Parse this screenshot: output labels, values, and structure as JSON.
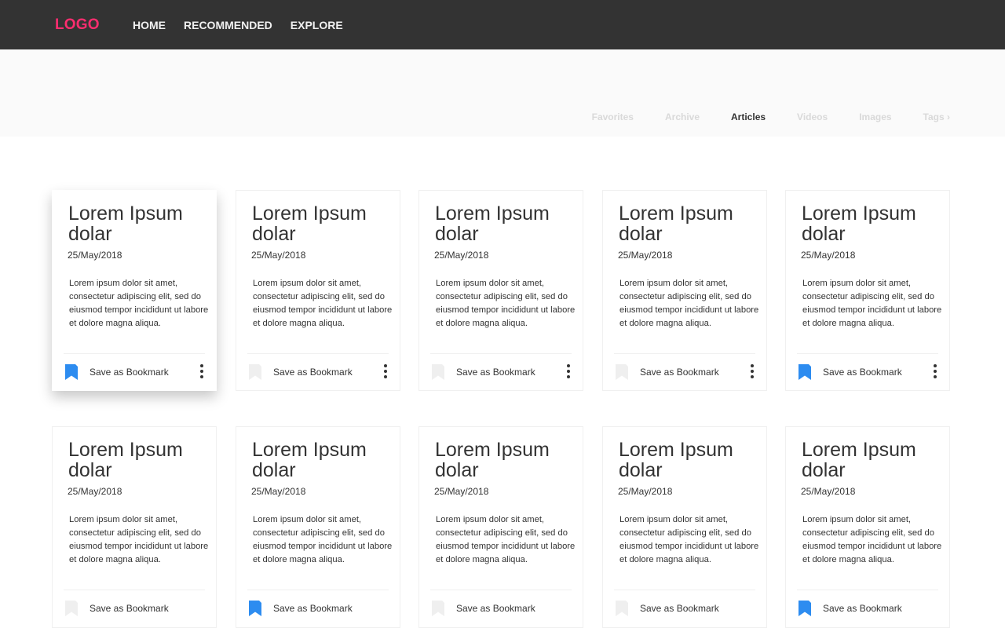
{
  "header": {
    "logo": "LOGO",
    "nav": [
      "HOME",
      "RECOMMENDED",
      "EXPLORE"
    ]
  },
  "filters": {
    "tabs": [
      "Favorites",
      "Archive",
      "Articles",
      "Videos",
      "Images",
      "Tags ›"
    ],
    "active": "Articles"
  },
  "colors": {
    "topbar": "#333333",
    "logo": "#ff2d6f",
    "bookmark_active": "#2d8cf0",
    "bookmark_inactive": "#efefef"
  },
  "cards": [
    {
      "title": "Lorem Ipsum dolar",
      "date": "25/May/2018",
      "body": "Lorem ipsum dolor sit amet, consectetur adipiscing elit, sed do eiusmod tempor incididunt ut labore et dolore magna aliqua.",
      "bookmark_label": "Save as Bookmark",
      "bookmarked": true,
      "raised": true,
      "more_menu": true
    },
    {
      "title": "Lorem Ipsum dolar",
      "date": "25/May/2018",
      "body": "Lorem ipsum dolor sit amet, consectetur adipiscing elit, sed do eiusmod tempor incididunt ut labore et dolore magna aliqua.",
      "bookmark_label": "Save as Bookmark",
      "bookmarked": false,
      "raised": false,
      "more_menu": true
    },
    {
      "title": "Lorem Ipsum dolar",
      "date": "25/May/2018",
      "body": "Lorem ipsum dolor sit amet, consectetur adipiscing elit, sed do eiusmod tempor incididunt ut labore et dolore magna aliqua.",
      "bookmark_label": "Save as Bookmark",
      "bookmarked": false,
      "raised": false,
      "more_menu": true
    },
    {
      "title": "Lorem Ipsum dolar",
      "date": "25/May/2018",
      "body": "Lorem ipsum dolor sit amet, consectetur adipiscing elit, sed do eiusmod tempor incididunt ut labore et dolore magna aliqua.",
      "bookmark_label": "Save as Bookmark",
      "bookmarked": false,
      "raised": false,
      "more_menu": true
    },
    {
      "title": "Lorem Ipsum dolar",
      "date": "25/May/2018",
      "body": "Lorem ipsum dolor sit amet, consectetur adipiscing elit, sed do eiusmod tempor incididunt ut labore et dolore magna aliqua.",
      "bookmark_label": "Save as Bookmark",
      "bookmarked": true,
      "raised": false,
      "more_menu": true
    },
    {
      "title": "Lorem Ipsum dolar",
      "date": "25/May/2018",
      "body": "Lorem ipsum dolor sit amet, consectetur adipiscing elit, sed do eiusmod tempor incididunt ut labore et dolore magna aliqua.",
      "bookmark_label": "Save as Bookmark",
      "bookmarked": false,
      "raised": false,
      "more_menu": false
    },
    {
      "title": "Lorem Ipsum dolar",
      "date": "25/May/2018",
      "body": "Lorem ipsum dolor sit amet, consectetur adipiscing elit, sed do eiusmod tempor incididunt ut labore et dolore magna aliqua.",
      "bookmark_label": "Save as Bookmark",
      "bookmarked": true,
      "raised": false,
      "more_menu": false
    },
    {
      "title": "Lorem Ipsum dolar",
      "date": "25/May/2018",
      "body": "Lorem ipsum dolor sit amet, consectetur adipiscing elit, sed do eiusmod tempor incididunt ut labore et dolore magna aliqua.",
      "bookmark_label": "Save as Bookmark",
      "bookmarked": false,
      "raised": false,
      "more_menu": false
    },
    {
      "title": "Lorem Ipsum dolar",
      "date": "25/May/2018",
      "body": "Lorem ipsum dolor sit amet, consectetur adipiscing elit, sed do eiusmod tempor incididunt ut labore et dolore magna aliqua.",
      "bookmark_label": "Save as Bookmark",
      "bookmarked": false,
      "raised": false,
      "more_menu": false
    },
    {
      "title": "Lorem Ipsum dolar",
      "date": "25/May/2018",
      "body": "Lorem ipsum dolor sit amet, consectetur adipiscing elit, sed do eiusmod tempor incididunt ut labore et dolore magna aliqua.",
      "bookmark_label": "Save as Bookmark",
      "bookmarked": true,
      "raised": false,
      "more_menu": false
    }
  ]
}
